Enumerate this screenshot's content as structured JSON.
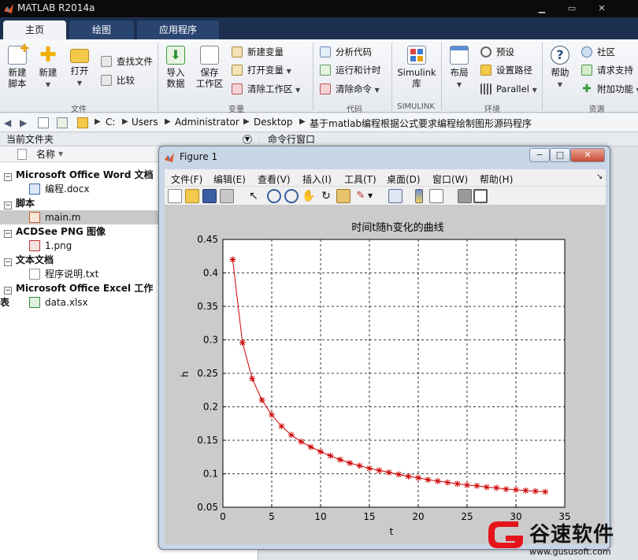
{
  "app": {
    "title": "MATLAB R2014a"
  },
  "tabs": [
    "主页",
    "绘图",
    "应用程序"
  ],
  "ribbon": {
    "file": {
      "new_script": "新建\n脚本",
      "new": "新建",
      "open": "打开",
      "find_files": "查找文件",
      "compare": "比较",
      "section": "文件"
    },
    "variable": {
      "import": "导入\n数据",
      "save_ws": "保存\n工作区",
      "new_var": "新建变量",
      "open_var": "打开变量",
      "clear_ws": "清除工作区",
      "section": "变量"
    },
    "code": {
      "analyze": "分析代码",
      "run_time": "运行和计时",
      "clear_cmd": "清除命令",
      "section": "代码"
    },
    "simulink": {
      "lib": "Simulink\n库",
      "section": "SIMULINK"
    },
    "env": {
      "layout": "布局",
      "prefs": "预设",
      "set_path": "设置路径",
      "parallel": "Parallel",
      "section": "环境"
    },
    "resources": {
      "help": "帮助",
      "community": "社区",
      "support": "请求支持",
      "addons": "附加功能",
      "section": "资源"
    }
  },
  "address": [
    "C:",
    "Users",
    "Administrator",
    "Desktop",
    "基于matlab编程根据公式要求编程绘制图形源码程序"
  ],
  "file_panel": {
    "title": "当前文件夹",
    "name_col": "名称",
    "groups": [
      {
        "label": "Microsoft Office Word 文档",
        "items": [
          "编程.docx"
        ]
      },
      {
        "label": "脚本",
        "items": [
          "main.m"
        ]
      },
      {
        "label": "ACDSee PNG 图像",
        "items": [
          "1.png"
        ]
      },
      {
        "label": "文本文档",
        "items": [
          "程序说明.txt"
        ]
      },
      {
        "label": "Microsoft Office Excel 工作表",
        "items": [
          "data.xlsx"
        ]
      }
    ]
  },
  "command_window": {
    "title": "命令行窗口"
  },
  "figure": {
    "title": "Figure 1",
    "menu": [
      "文件(F)",
      "编辑(E)",
      "查看(V)",
      "插入(I)",
      "工具(T)",
      "桌面(D)",
      "窗口(W)",
      "帮助(H)"
    ]
  },
  "chart_data": {
    "type": "line",
    "title": "时间t随h变化的曲线",
    "xlabel": "t",
    "ylabel": "h",
    "xlim": [
      0,
      35
    ],
    "ylim": [
      0.05,
      0.45
    ],
    "xticks": [
      0,
      5,
      10,
      15,
      20,
      25,
      30,
      35
    ],
    "yticks": [
      0.05,
      0.1,
      0.15,
      0.2,
      0.25,
      0.3,
      0.35,
      0.4,
      0.45
    ],
    "grid": true,
    "series": [
      {
        "color": "#cc0000",
        "marker": "*",
        "x": [
          1,
          2,
          3,
          4,
          5,
          6,
          7,
          8,
          9,
          10,
          11,
          12,
          13,
          14,
          15,
          16,
          17,
          18,
          19,
          20,
          21,
          22,
          23,
          24,
          25,
          26,
          27,
          28,
          29,
          30,
          31,
          32,
          33
        ],
        "values": [
          0.42,
          0.296,
          0.242,
          0.21,
          0.188,
          0.171,
          0.158,
          0.148,
          0.14,
          0.133,
          0.127,
          0.121,
          0.116,
          0.112,
          0.108,
          0.105,
          0.102,
          0.099,
          0.096,
          0.094,
          0.091,
          0.089,
          0.087,
          0.085,
          0.083,
          0.082,
          0.08,
          0.079,
          0.077,
          0.076,
          0.075,
          0.074,
          0.073
        ]
      }
    ]
  },
  "watermark": {
    "brand": "谷速软件",
    "url": "www.gususoft.com"
  },
  "colors": {
    "accent": "#1d2f4f",
    "line": "#cc0000",
    "selected": "#c9c9c9"
  }
}
